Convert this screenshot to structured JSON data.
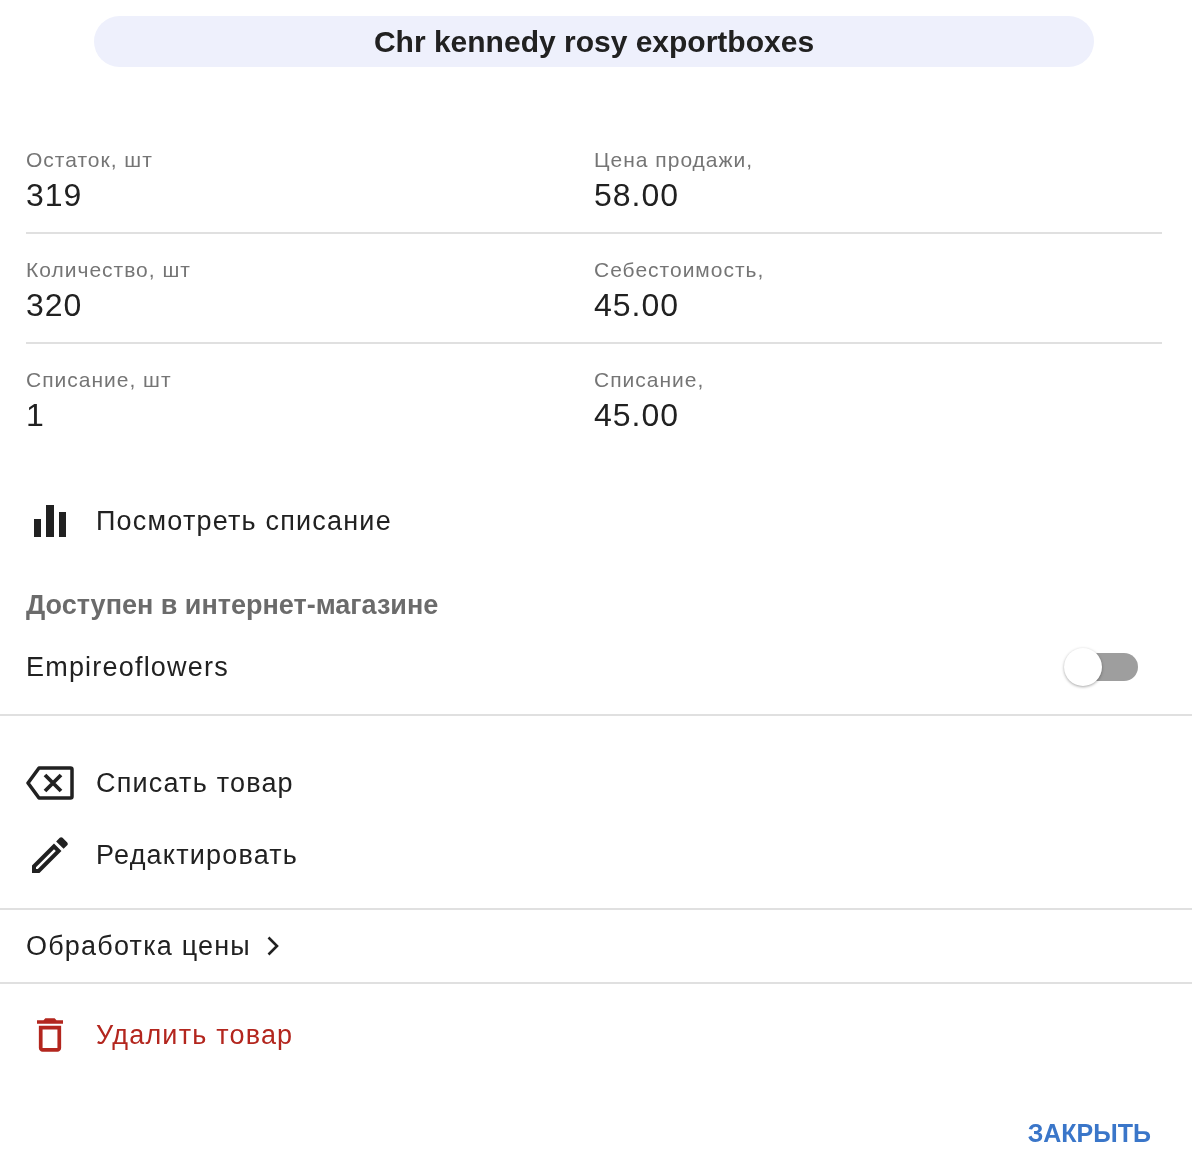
{
  "header": {
    "title": "Chr kennedy rosy exportboxes"
  },
  "stats_rows": [
    {
      "cells": [
        {
          "label": "Остаток, шт",
          "value": "319"
        },
        {
          "label": "Цена продажи,",
          "value": "58.00"
        }
      ]
    },
    {
      "cells": [
        {
          "label": "Количество, шт",
          "value": "320"
        },
        {
          "label": "Себестоимость,",
          "value": "45.00"
        }
      ]
    },
    {
      "cells": [
        {
          "label": "Списание, шт",
          "value": "1"
        },
        {
          "label": "Списание,",
          "value": "45.00"
        }
      ]
    }
  ],
  "report_action": {
    "kind": "chart",
    "label": "Посмотреть списание"
  },
  "online_store": {
    "heading": "Доступен в интернет-магазине",
    "stores": [
      {
        "name": "Empireoflowers",
        "on": false
      }
    ]
  },
  "actions": [
    {
      "kind": "write-off",
      "label": "Списать товар"
    },
    {
      "kind": "edit",
      "label": "Редактировать"
    }
  ],
  "price_processing": {
    "label": "Обработка цены"
  },
  "delete_action": {
    "kind": "delete",
    "label": "Удалить товар"
  },
  "close_button": {
    "label": "ЗАКРЫТЬ"
  }
}
